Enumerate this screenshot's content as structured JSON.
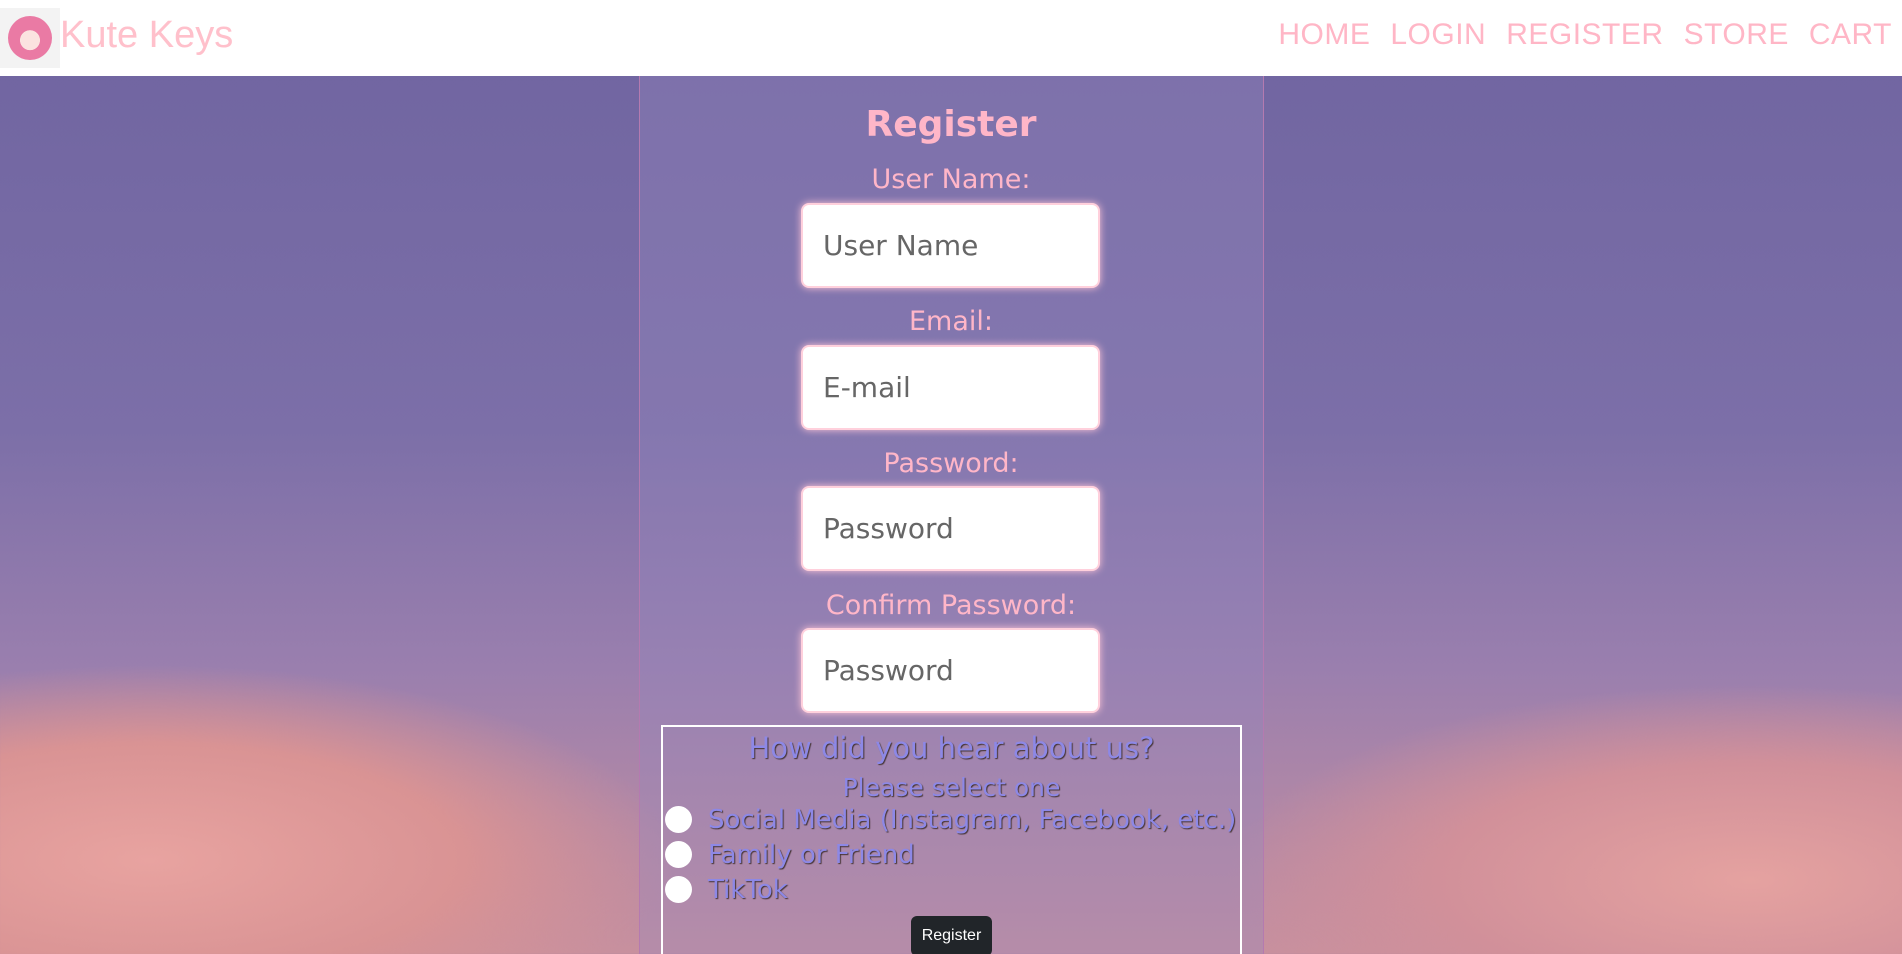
{
  "header": {
    "brand": "Kute Keys",
    "nav": [
      "HOME",
      "LOGIN",
      "REGISTER",
      "STORE",
      "CART"
    ]
  },
  "form": {
    "title": "Register",
    "fields": [
      {
        "label": "User Name:",
        "placeholder": "User Name"
      },
      {
        "label": "Email:",
        "placeholder": "E-mail"
      },
      {
        "label": "Password:",
        "placeholder": "Password"
      },
      {
        "label": "Confirm Password:",
        "placeholder": "Password"
      }
    ],
    "survey": {
      "question": "How did you hear about us?",
      "hint": "Please select one",
      "options": [
        "Social Media (Instagram, Facebook, etc.)",
        "Family or Friend",
        "TikTok"
      ]
    },
    "submit": "Register"
  },
  "colors": {
    "accent": "#ffb6c8",
    "survey_text": "#8d88e6",
    "button": "#212529"
  }
}
